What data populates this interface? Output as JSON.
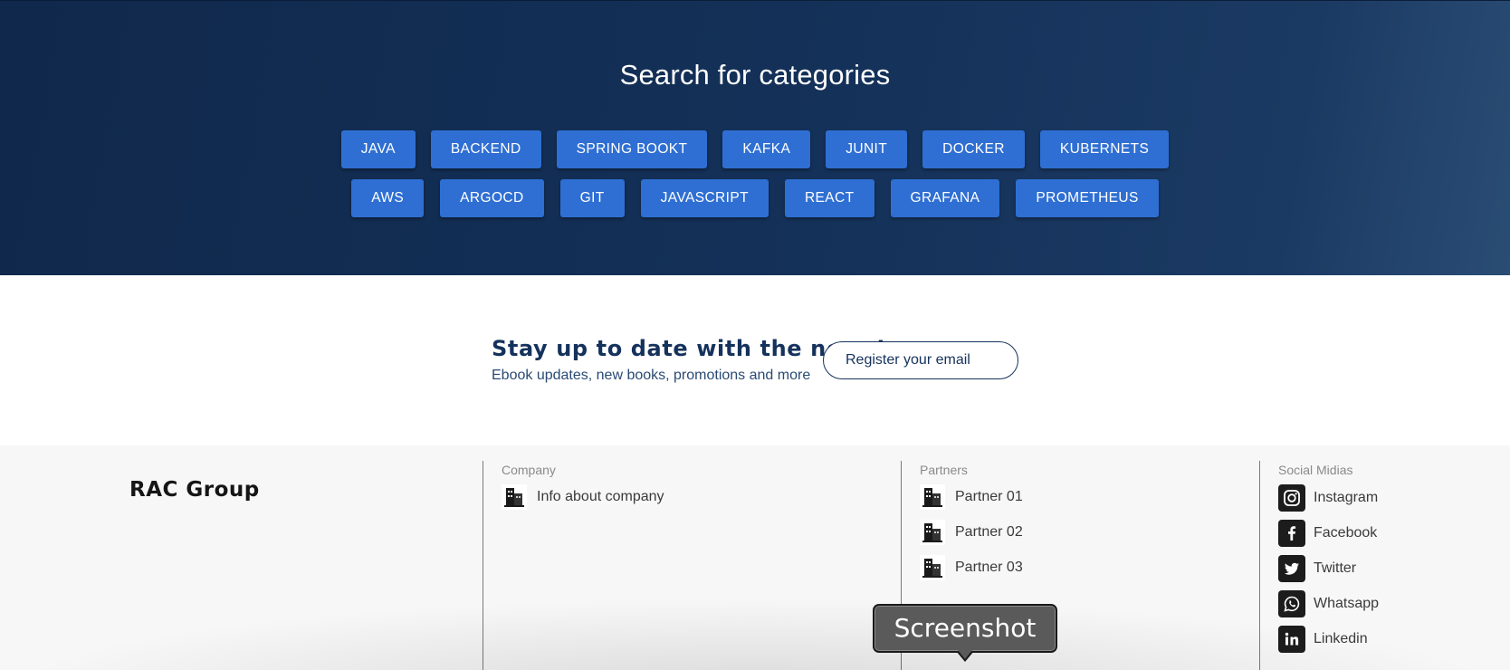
{
  "hero": {
    "title": "Search for categories",
    "row1": [
      "JAVA",
      "BACKEND",
      "SPRING BOOKT",
      "KAFKA",
      "JUNIT",
      "DOCKER",
      "KUBERNETS"
    ],
    "row2": [
      "AWS",
      "ARGOCD",
      "GIT",
      "JAVASCRIPT",
      "REACT",
      "GRAFANA",
      "PROMETHEUS"
    ]
  },
  "newsletter": {
    "title": "Stay up to date with the news!",
    "subtitle": "Ebook updates, new books, promotions and more",
    "register_label": "Register your email"
  },
  "footer": {
    "brand": "RAC Group",
    "company": {
      "heading": "Company",
      "items": [
        {
          "label": "Info about company",
          "icon": "building-icon"
        }
      ]
    },
    "partners": {
      "heading": "Partners",
      "items": [
        {
          "label": "Partner 01",
          "icon": "building-icon"
        },
        {
          "label": "Partner 02",
          "icon": "building-icon"
        },
        {
          "label": "Partner 03",
          "icon": "building-icon"
        }
      ]
    },
    "social": {
      "heading": "Social Midias",
      "items": [
        {
          "label": "Instagram",
          "icon": "instagram-icon"
        },
        {
          "label": "Facebook",
          "icon": "facebook-icon"
        },
        {
          "label": "Twitter",
          "icon": "twitter-icon"
        },
        {
          "label": "Whatsapp",
          "icon": "whatsapp-icon"
        },
        {
          "label": "Linkedin",
          "icon": "linkedin-icon"
        }
      ]
    }
  },
  "tooltip": {
    "label": "Screenshot"
  },
  "colors": {
    "hero_bg": "#143159",
    "category_button": "#2f6fd3",
    "heading_navy": "#15325c",
    "footer_bg": "#f7f7f7"
  }
}
